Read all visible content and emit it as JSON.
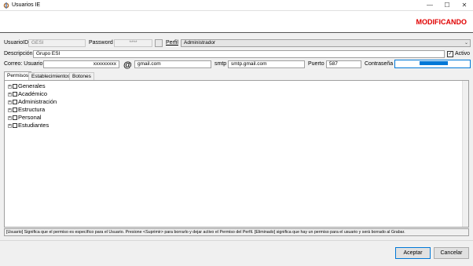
{
  "window": {
    "title": "Usuarios IE",
    "app_icon": "gear-wrench-icon",
    "minimize_glyph": "—",
    "maximize_glyph": "☐",
    "close_glyph": "✕"
  },
  "mode_label": "MODIFICANDO",
  "form": {
    "usuario_id_label": "UsuarioID",
    "usuario_id_value": "GESI",
    "password_label": "Password",
    "password_value": "****",
    "perfil_label": "Perfil",
    "perfil_value": "Administrador",
    "descripcion_label": "Descripción",
    "descripcion_value": "Grupo ESI",
    "activo_label": "Activo",
    "activo_checked": true,
    "correo_label": "Correo: Usuario",
    "correo_value": "xxxxxxxxx",
    "at_symbol": "@",
    "domain_value": "gmail.com",
    "smtp_label": "smtp",
    "smtp_value": "smtp.gmail.com",
    "puerto_label": "Puerto",
    "puerto_value": "587",
    "contrasena_label": "Contraseña",
    "contrasena_value": ""
  },
  "tabs": [
    {
      "label": "Permisos",
      "active": true
    },
    {
      "label": "Establecimientos",
      "active": false
    },
    {
      "label": "Botones",
      "active": false
    }
  ],
  "tree": [
    {
      "label": "Generales"
    },
    {
      "label": "Académico"
    },
    {
      "label": "Administración"
    },
    {
      "label": "Estructura"
    },
    {
      "label": "Personal"
    },
    {
      "label": "Estudiantes"
    }
  ],
  "tree_expand_glyph": "+",
  "info_text": "[Usuario] Significa que el permiso es específico para el Usuario. Presione <Suprimir> para borrarlo y dejar activo el Permiso del Perfil. [Eliminado] significa que hay un permiso para el usuario y será borrado al Grabar.",
  "buttons": {
    "accept": "Aceptar",
    "cancel": "Cancelar"
  },
  "colors": {
    "mode_label": "#e00000",
    "selection": "#0078d7"
  }
}
